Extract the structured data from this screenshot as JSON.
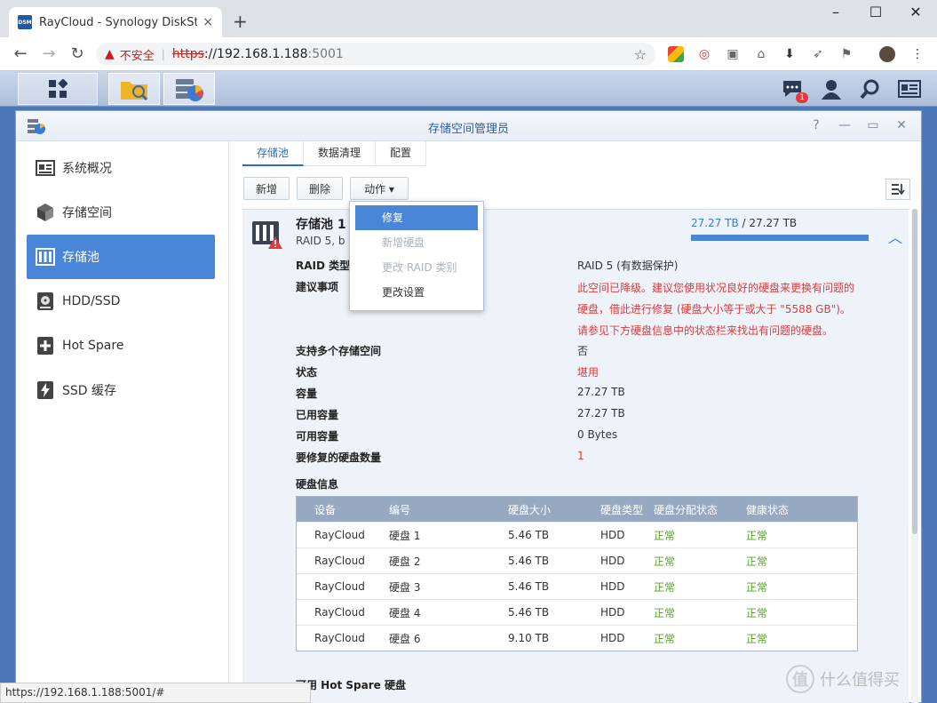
{
  "browser": {
    "tab_favicon_text": "DSM",
    "tab_title": "RayCloud - Synology DiskStati",
    "tab_close": "×",
    "new_tab": "+",
    "minimize": "–",
    "maximize": "☐",
    "close": "✕",
    "back": "←",
    "forward": "→",
    "reload": "↻",
    "security_label": "不安全",
    "url_scheme": "https",
    "url_sep": "://",
    "url_host": "192.168.1.188",
    "url_port": ":5001",
    "bookmark_star": "☆",
    "status_url": "https://192.168.1.188:5001/#"
  },
  "taskbar": {
    "notification_count": "1"
  },
  "window": {
    "title": "存储空间管理员",
    "help": "?",
    "minimize": "—",
    "maximize": "▭",
    "close": "✕"
  },
  "sidebar": {
    "items": [
      {
        "label": "系统概况",
        "icon": "overview-icon"
      },
      {
        "label": "存储空间",
        "icon": "volume-icon"
      },
      {
        "label": "存储池",
        "icon": "storage-pool-icon",
        "active": true
      },
      {
        "label": "HDD/SSD",
        "icon": "hdd-icon"
      },
      {
        "label": "Hot Spare",
        "icon": "hot-spare-icon"
      },
      {
        "label": "SSD 缓存",
        "icon": "ssd-cache-icon"
      }
    ]
  },
  "tabs": [
    "存储池",
    "数据清理",
    "配置"
  ],
  "toolbar": {
    "create": "新增",
    "delete": "删除",
    "action": "动作 ▾"
  },
  "action_menu": {
    "items": [
      {
        "label": "修复",
        "state": "highlighted"
      },
      {
        "label": "新增硬盘",
        "state": "disabled"
      },
      {
        "label": "更改 RAID 类别",
        "state": "disabled"
      },
      {
        "label": "更改设置",
        "state": "normal"
      }
    ]
  },
  "pool": {
    "name": "存储池 1",
    "subtitle": "RAID 5, b",
    "used": "27.27 TB",
    "total_sep": " / ",
    "total": "27.27 TB",
    "usage_fraction": 1.0,
    "collapse": "︿",
    "details": [
      {
        "label": "RAID 类型",
        "value": "RAID 5 (有数据保护)"
      },
      {
        "label": "建议事项",
        "value": ""
      },
      {
        "label": "支持多个存储空间",
        "value": "否"
      },
      {
        "label": "状态",
        "value": "堪用"
      },
      {
        "label": "容量",
        "value": "27.27 TB"
      },
      {
        "label": "已用容量",
        "value": "27.27 TB"
      },
      {
        "label": "可用容量",
        "value": "0 Bytes"
      },
      {
        "label": "要修复的硬盘数量",
        "value": "1"
      }
    ],
    "warning_lines": [
      "此空间已降级。建议您使用状况良好的硬盘来更换有问题的",
      "硬盘，借此进行修复 (硬盘大小等于或大于 \"5588 GB\")。",
      "请参见下方硬盘信息中的状态栏来找出有问题的硬盘。"
    ]
  },
  "disk_info": {
    "title": "硬盘信息",
    "headers": [
      "设备",
      "编号",
      "硬盘大小",
      "硬盘类型",
      "硬盘分配状态",
      "健康状态"
    ],
    "rows": [
      [
        "RayCloud",
        "硬盘 1",
        "5.46 TB",
        "HDD",
        "正常",
        "正常"
      ],
      [
        "RayCloud",
        "硬盘 2",
        "5.46 TB",
        "HDD",
        "正常",
        "正常"
      ],
      [
        "RayCloud",
        "硬盘 3",
        "5.46 TB",
        "HDD",
        "正常",
        "正常"
      ],
      [
        "RayCloud",
        "硬盘 4",
        "5.46 TB",
        "HDD",
        "正常",
        "正常"
      ],
      [
        "RayCloud",
        "硬盘 6",
        "9.10 TB",
        "HDD",
        "正常",
        "正常"
      ]
    ]
  },
  "hot_spare_title": "可用 Hot Spare 硬盘",
  "watermark": {
    "logo": "值",
    "text": "什么值得买"
  }
}
